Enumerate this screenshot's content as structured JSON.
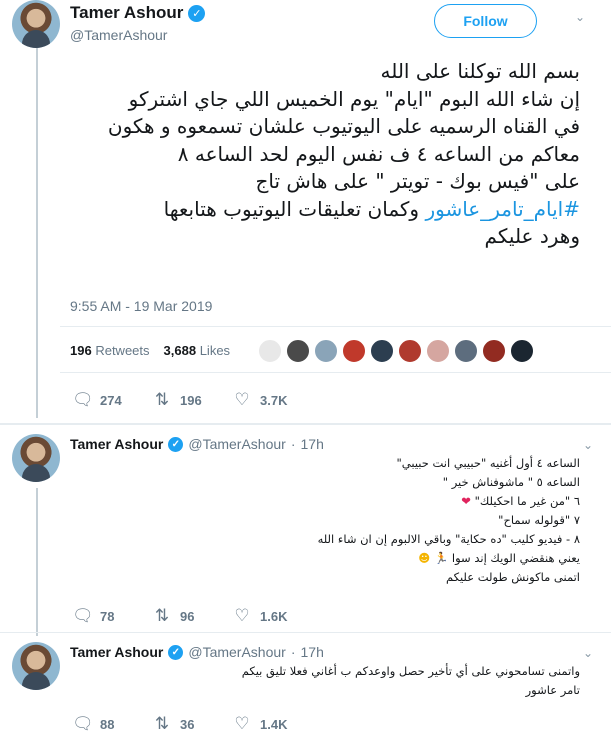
{
  "main_tweet": {
    "name": "Tamer Ashour",
    "handle": "@TamerAshour",
    "follow_label": "Follow",
    "lines": [
      "بسم الله توكلنا على الله",
      "إن شاء الله البوم \"ايام\" يوم الخميس اللي جاي اشتركو",
      "في القناه الرسميه على اليوتيوب علشان تسمعوه و هكون",
      "معاكم من الساعه ٤   ف نفس اليوم لحد الساعه ٨",
      "على \"فيس بوك - تويتر  \"  على هاش تاج"
    ],
    "hashtag": "#ايام_تامر_عاشور",
    "hashtag_line_rest": "وكمان تعليقات اليوتيوب هتابعها",
    "last_line": "وهرد عليكم",
    "timestamp": "9:55 AM - 19 Mar 2019",
    "retweets_count": "196",
    "retweets_label": "Retweets",
    "likes_count": "3,688",
    "likes_label": "Likes",
    "reply_count": "274",
    "retweet_action_count": "196",
    "like_action_count": "3.7K"
  },
  "replies": [
    {
      "name": "Tamer Ashour",
      "handle": "@TamerAshour",
      "time": "17h",
      "lines": [
        "الساعه ٤  أول أغنيه \"حبيبي انت حبيبي\"",
        "الساعه ٥  \" ماشوفناش خير \"",
        "٦  \"من غير ما احكيلك\"",
        "٧ \"قولوله سماح\"",
        "٨ - فيديو كليب \"ده حكاية\" وباقي الالبوم إن ان شاء الله",
        "يعني هنقضي الويك إند سوا",
        "اتمنى ماكونش طولت عليكم"
      ],
      "reply_count": "78",
      "retweet_count": "96",
      "like_count": "1.6K"
    },
    {
      "name": "Tamer Ashour",
      "handle": "@TamerAshour",
      "time": "17h",
      "lines": [
        "واتمنى تسامحوني على أي تأخير حصل واوعدكم ب أغاني فعلا تليق بيكم",
        "تامر عاشور"
      ],
      "reply_count": "88",
      "retweet_count": "36",
      "like_count": "1.4K"
    }
  ],
  "icons": {
    "reply": "reply-icon",
    "retweet": "retweet-icon",
    "like": "heart-icon",
    "verified": "verified-badge-icon",
    "caret": "chevron-down-icon"
  },
  "colors": {
    "accent": "#1da1f2",
    "hashtag": "#1b95e0",
    "muted": "#657786",
    "heart_emoji": "#e0245e"
  }
}
